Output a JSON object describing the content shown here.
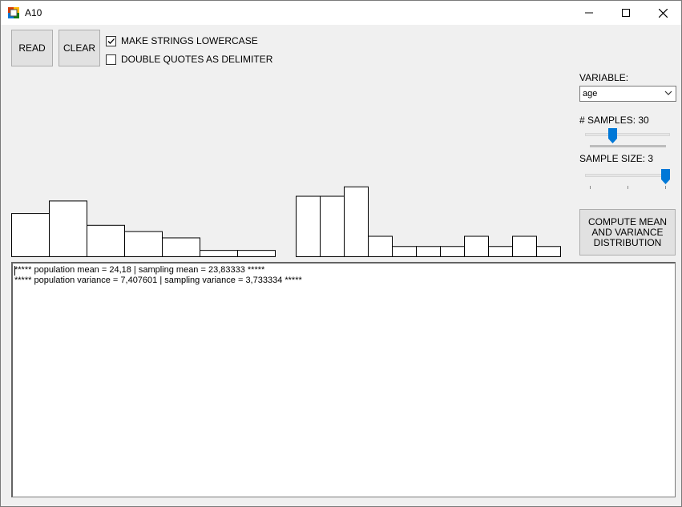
{
  "window": {
    "title": "A10"
  },
  "toolbar": {
    "read_label": "READ",
    "clear_label": "CLEAR",
    "lowercase_label": "MAKE STRINGS LOWERCASE",
    "lowercase_checked": true,
    "dquote_label": "DOUBLE QUOTES AS DELIMITER",
    "dquote_checked": false
  },
  "controls": {
    "variable_label": "VARIABLE:",
    "variable_value": "age",
    "samples_label": "# SAMPLES: 30",
    "samples_value": 30,
    "sample_size_label": "SAMPLE SIZE: 3",
    "sample_size_value": 3,
    "compute_label": "COMPUTE MEAN AND VARIANCE DISTRIBUTION"
  },
  "chart_data": {
    "type": "bar",
    "title": "",
    "groups": [
      {
        "values": [
          55,
          71,
          40,
          32,
          24,
          8,
          8
        ]
      },
      {
        "values": [
          77,
          77,
          89,
          26,
          13,
          13,
          13,
          26,
          13,
          26,
          13
        ]
      }
    ]
  },
  "output": {
    "line1": "***** population mean = 24,18 | sampling mean = 23,83333 *****",
    "line2": "***** population variance = 7,407601 | sampling variance = 3,733334 *****"
  },
  "colors": {
    "accent": "#0078d7",
    "button_bg": "#e1e1e1",
    "window_bg": "#f0f0f0"
  }
}
